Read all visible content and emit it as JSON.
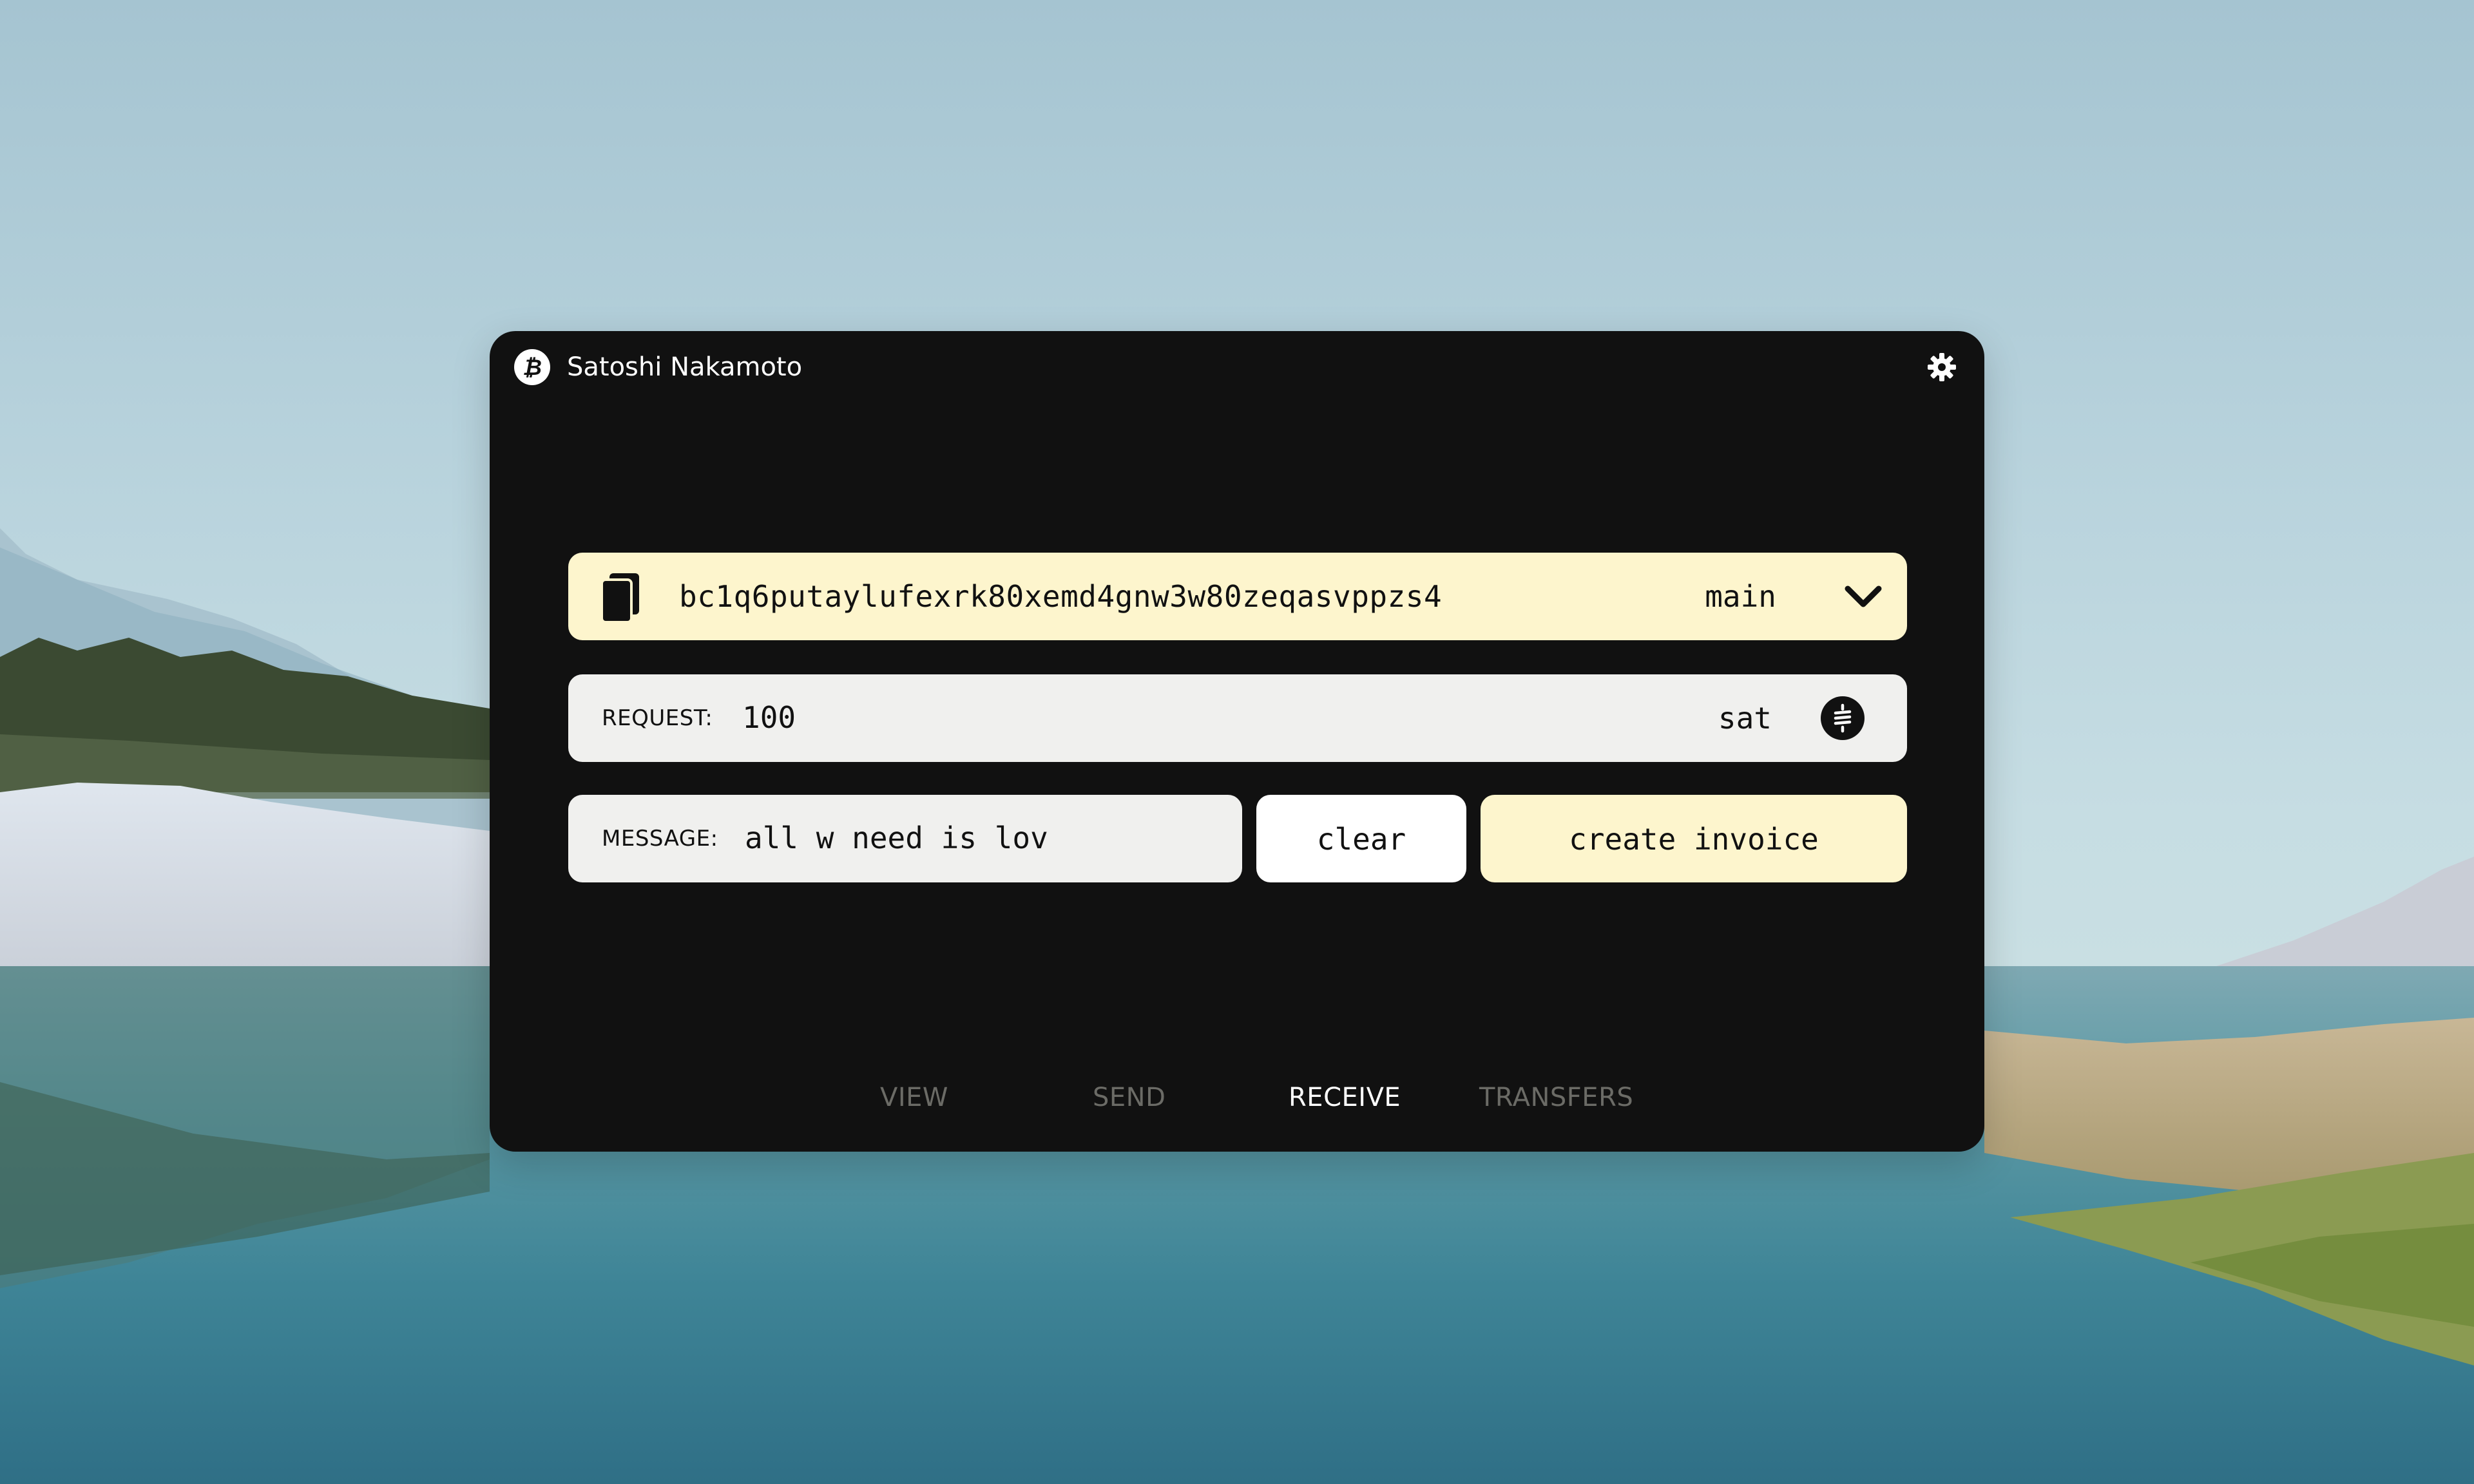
{
  "window": {
    "title": "Satoshi Nakamoto",
    "logo_icon": "bitcoin-icon",
    "settings_icon": "gear-icon"
  },
  "address": {
    "value": "bc1q6putaylufexrk80xemd4gnw3w80zeqasvppzs4",
    "network": "main",
    "copy_icon": "copy-icon",
    "dropdown_icon": "chevron-down-icon"
  },
  "request": {
    "label": "REQUEST:",
    "amount": "100",
    "unit": "sat",
    "unit_icon": "sats-icon"
  },
  "message": {
    "label": "MESSAGE:",
    "value": "all w need is lov"
  },
  "actions": {
    "clear_label": "clear",
    "create_label": "create invoice"
  },
  "tabs": [
    {
      "label": "VIEW",
      "active": false
    },
    {
      "label": "SEND",
      "active": false
    },
    {
      "label": "RECEIVE",
      "active": true
    },
    {
      "label": "TRANSFERS",
      "active": false
    }
  ],
  "colors": {
    "window_bg": "#111111",
    "accent_cream": "#fdf5cd",
    "field_bg": "#f0f0ee",
    "tab_inactive": "#6b6b66",
    "tab_active": "#ffffff"
  }
}
